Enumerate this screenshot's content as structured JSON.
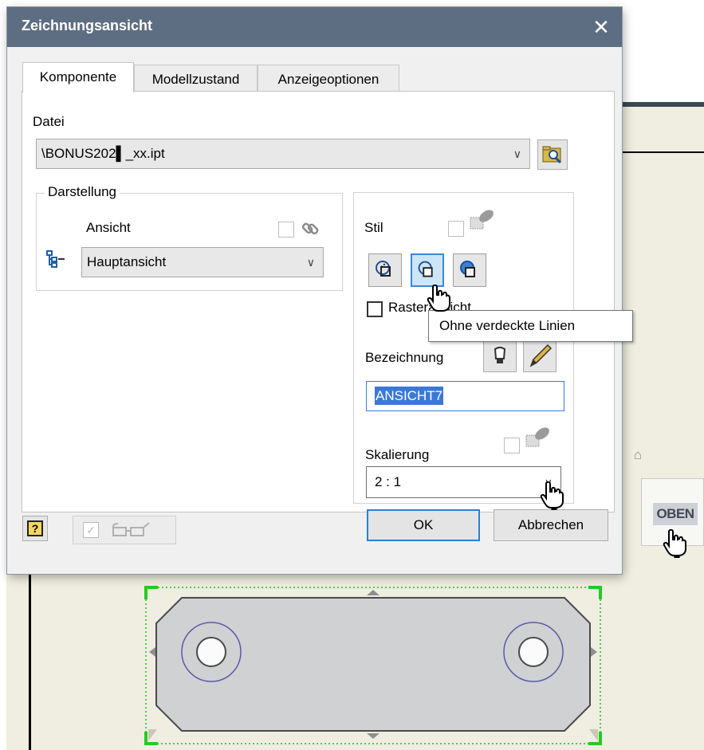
{
  "dialog": {
    "title": "Zeichnungsansicht",
    "close_glyph": "✕"
  },
  "tabs": [
    {
      "label": "Komponente",
      "active": true
    },
    {
      "label": "Modellzustand",
      "active": false
    },
    {
      "label": "Anzeigeoptionen",
      "active": false
    }
  ],
  "datei": {
    "label": "Datei",
    "value": "\\BONUS202▌_xx.ipt"
  },
  "darstellung": {
    "group_title": "Darstellung",
    "ansicht_label": "Ansicht",
    "ansicht_value": "Hauptansicht"
  },
  "stil": {
    "label": "Stil",
    "buttons": [
      "hidden-lines-icon",
      "hidden-lines-removed-icon",
      "shaded-icon"
    ],
    "active_index": 1,
    "rasteransicht_label": "Rasteransicht",
    "tooltip": "Ohne verdeckte Linien"
  },
  "bezeichnung": {
    "label": "Bezeichnung",
    "value": "ANSICHT7"
  },
  "skalierung": {
    "label": "Skalierung",
    "value": "2 : 1"
  },
  "footer": {
    "ok_label": "OK",
    "cancel_label": "Abbrechen"
  },
  "viewcube": {
    "label": "OBEN"
  },
  "colors": {
    "titlebar": "#5e6e82",
    "selection": "#3b78d8",
    "sheet": "#efeee0",
    "grip_green": "#22cc22"
  }
}
